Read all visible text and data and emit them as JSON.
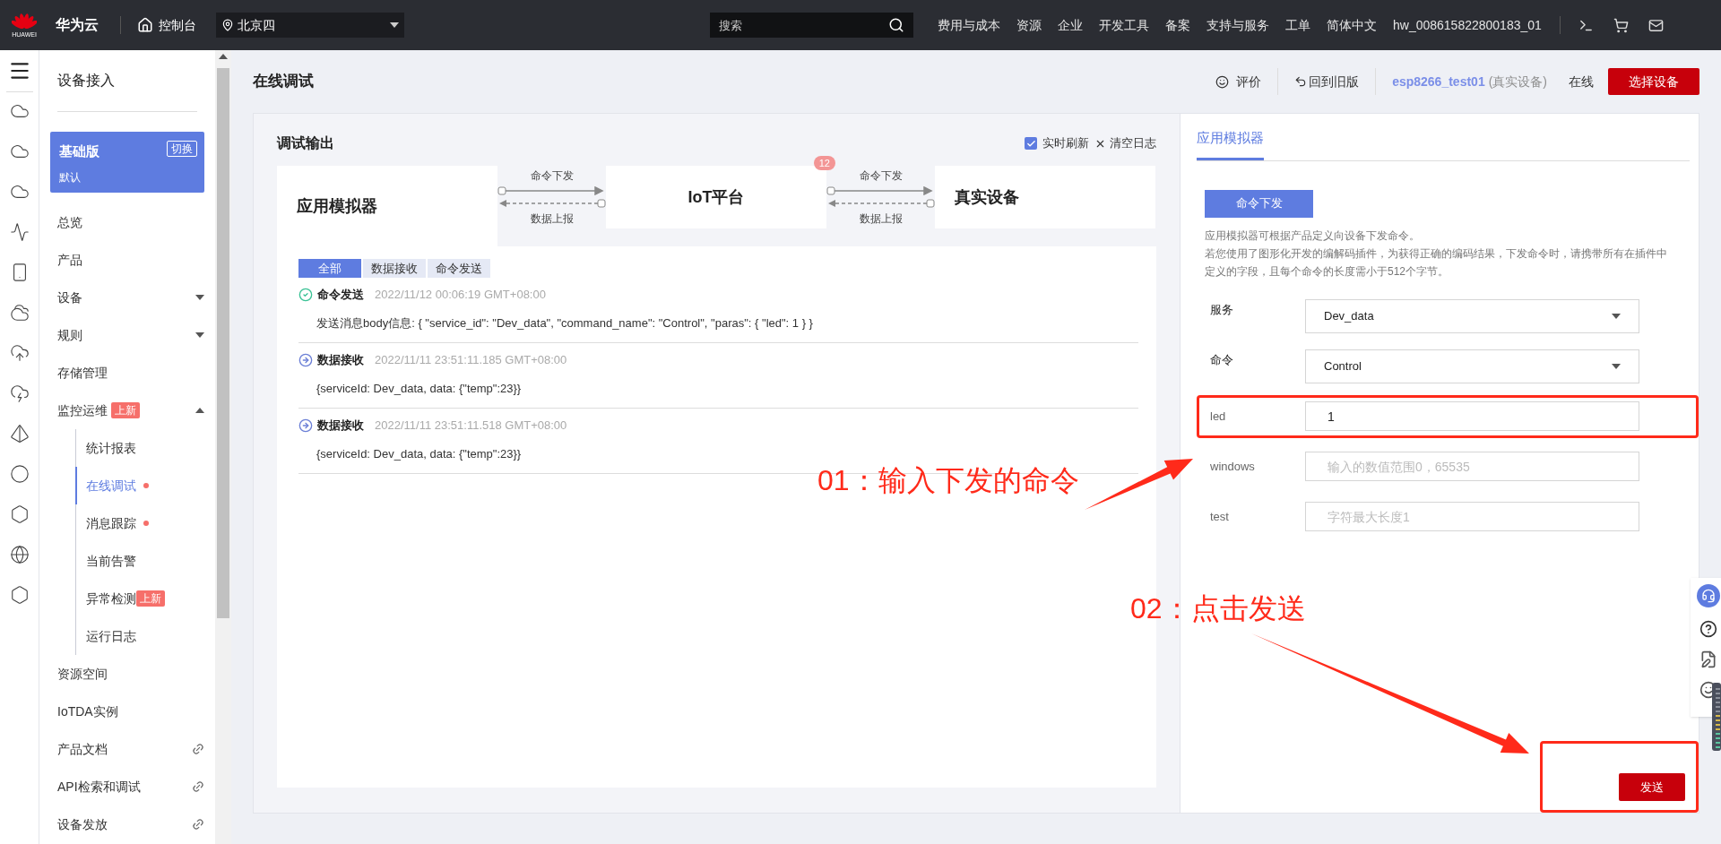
{
  "top_bar": {
    "logo_text": "HUAWEI",
    "brand": "华为云",
    "console": "控制台",
    "region": "北京四",
    "search": {
      "placeholder": "搜索"
    },
    "menu": [
      "费用与成本",
      "资源",
      "企业",
      "开发工具",
      "备案",
      "支持与服务",
      "工单",
      "简体中文"
    ],
    "user": "hw_008615822800183_01"
  },
  "sidebar": {
    "title": "设备接入",
    "edition": {
      "name": "基础版",
      "sub": "默认",
      "switch": "切换"
    },
    "items": [
      {
        "kind": "link",
        "label": "总览",
        "selected": false
      },
      {
        "kind": "link",
        "label": "产品",
        "selected": false
      },
      {
        "kind": "group",
        "label": "设备",
        "selected": false,
        "expanded": false
      },
      {
        "kind": "group",
        "label": "规则",
        "selected": false,
        "expanded": false
      },
      {
        "kind": "link",
        "label": "存储管理",
        "selected": false
      },
      {
        "kind": "group",
        "label": "监控运维",
        "selected": false,
        "expanded": true,
        "badge": "上新",
        "children": [
          {
            "label": "统计报表",
            "selected": false,
            "dot": false
          },
          {
            "label": "在线调试",
            "selected": true,
            "dot": true
          },
          {
            "label": "消息跟踪",
            "selected": false,
            "dot": true
          },
          {
            "label": "当前告警",
            "selected": false,
            "dot": false
          },
          {
            "label": "异常检测",
            "selected": false,
            "dot": false,
            "badge": "上新"
          },
          {
            "label": "运行日志",
            "selected": false,
            "dot": false
          }
        ]
      },
      {
        "kind": "link",
        "label": "资源空间",
        "selected": false
      },
      {
        "kind": "link",
        "label": "IoTDA实例",
        "selected": false
      },
      {
        "kind": "external",
        "label": "产品文档",
        "selected": false
      },
      {
        "kind": "external",
        "label": "API检索和调试",
        "selected": false
      },
      {
        "kind": "external",
        "label": "设备发放",
        "selected": false
      }
    ]
  },
  "page": {
    "title": "在线调试",
    "rate": "评价",
    "old_version": "回到旧版",
    "device": "esp8266_test01",
    "device_type": "(真实设备)",
    "status": "在线",
    "select_device": "选择设备"
  },
  "debug": {
    "title": "调试输出",
    "auto_refresh": {
      "label": "实时刷新",
      "checked": true
    },
    "clear": "清空日志",
    "nodes": [
      {
        "label": "应用模拟器",
        "selected": true
      },
      {
        "label": "IoT平台",
        "selected": false,
        "badge": "12"
      },
      {
        "label": "真实设备",
        "selected": false
      }
    ],
    "links": [
      {
        "down": "命令下发",
        "up": "数据上报"
      },
      {
        "down": "命令下发",
        "up": "数据上报"
      }
    ],
    "filters": [
      {
        "label": "全部",
        "selected": true
      },
      {
        "label": "数据接收",
        "selected": false
      },
      {
        "label": "命令发送",
        "selected": false
      }
    ],
    "logs": [
      {
        "kind": "sent",
        "title": "命令发送",
        "time": "2022/11/12 00:06:19 GMT+08:00",
        "body": "发送消息body信息: { \"service_id\": \"Dev_data\", \"command_name\": \"Control\", \"paras\": { \"led\": 1 } }"
      },
      {
        "kind": "received",
        "title": "数据接收",
        "time": "2022/11/11 23:51:11.185 GMT+08:00",
        "body": "{serviceId: Dev_data, data: {\"temp\":23}}"
      },
      {
        "kind": "received",
        "title": "数据接收",
        "time": "2022/11/11 23:51:11.518 GMT+08:00",
        "body": "{serviceId: Dev_data, data: {\"temp\":23}}"
      }
    ]
  },
  "simulator": {
    "tab": "应用模拟器",
    "command_button": "命令下发",
    "description": [
      "应用模拟器可根据产品定义向设备下发命令。",
      "若您使用了图形化开发的编解码插件，为获得正确的编码结果，下发命令时，请携带所有在插件中定义的字段，且每个命令的长度需小于512个字节。"
    ],
    "fields": [
      {
        "kind": "select",
        "label": "服务",
        "value": "Dev_data",
        "highlighted": false
      },
      {
        "kind": "select",
        "label": "命令",
        "value": "Control",
        "highlighted": false
      },
      {
        "kind": "input",
        "label": "led",
        "value": "1",
        "highlighted": true
      },
      {
        "kind": "input",
        "label": "windows",
        "placeholder": "输入的数值范围0，65535",
        "highlighted": false
      },
      {
        "kind": "input",
        "label": "test",
        "placeholder": "字符最大长度1",
        "highlighted": false
      }
    ],
    "send": {
      "label": "发送",
      "highlighted": true
    }
  },
  "annotations": [
    {
      "text": "01：输入下发的命令"
    },
    {
      "text": "02：点击发送"
    }
  ]
}
